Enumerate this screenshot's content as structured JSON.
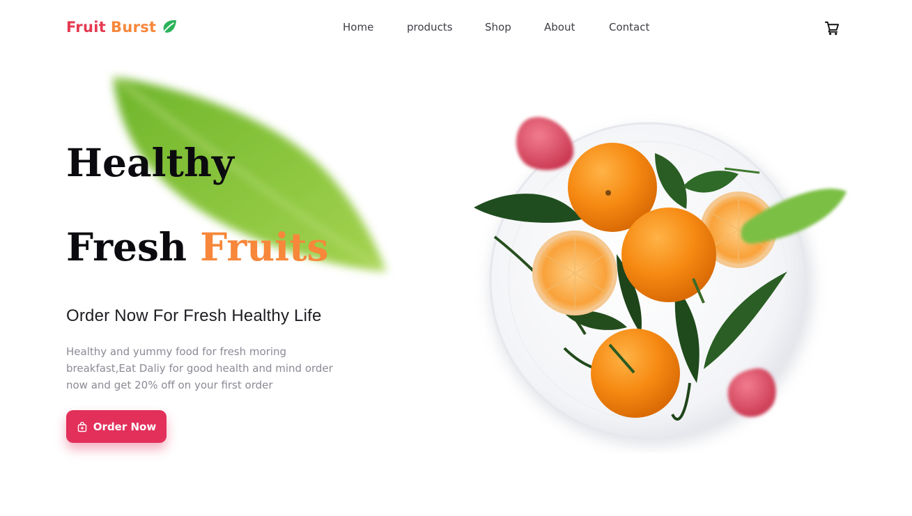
{
  "brand": {
    "word1": "Fruit",
    "word2": "Burst",
    "icon": "leaf-icon"
  },
  "nav": {
    "items": [
      {
        "label": "Home"
      },
      {
        "label": "products"
      },
      {
        "label": "Shop"
      },
      {
        "label": "About"
      },
      {
        "label": "Contact"
      }
    ],
    "cart_icon": "cart-icon"
  },
  "hero": {
    "line1": "Healthy",
    "line2_word1": "Fresh",
    "line2_word2": "Fruits",
    "subtitle": "Order Now For Fresh Healthy Life",
    "description": "Healthy and yummy food for fresh moring breakfast,Eat Daliy for good health and mind order now and get 20% off on your first order",
    "cta": {
      "label": "Order Now",
      "icon": "shopping-bag-icon"
    }
  },
  "colors": {
    "primary": "#e2305b",
    "accent": "#f7873a",
    "brand_red": "#e53950",
    "heading": "#0b0b0f",
    "muted": "#8a8a94"
  }
}
